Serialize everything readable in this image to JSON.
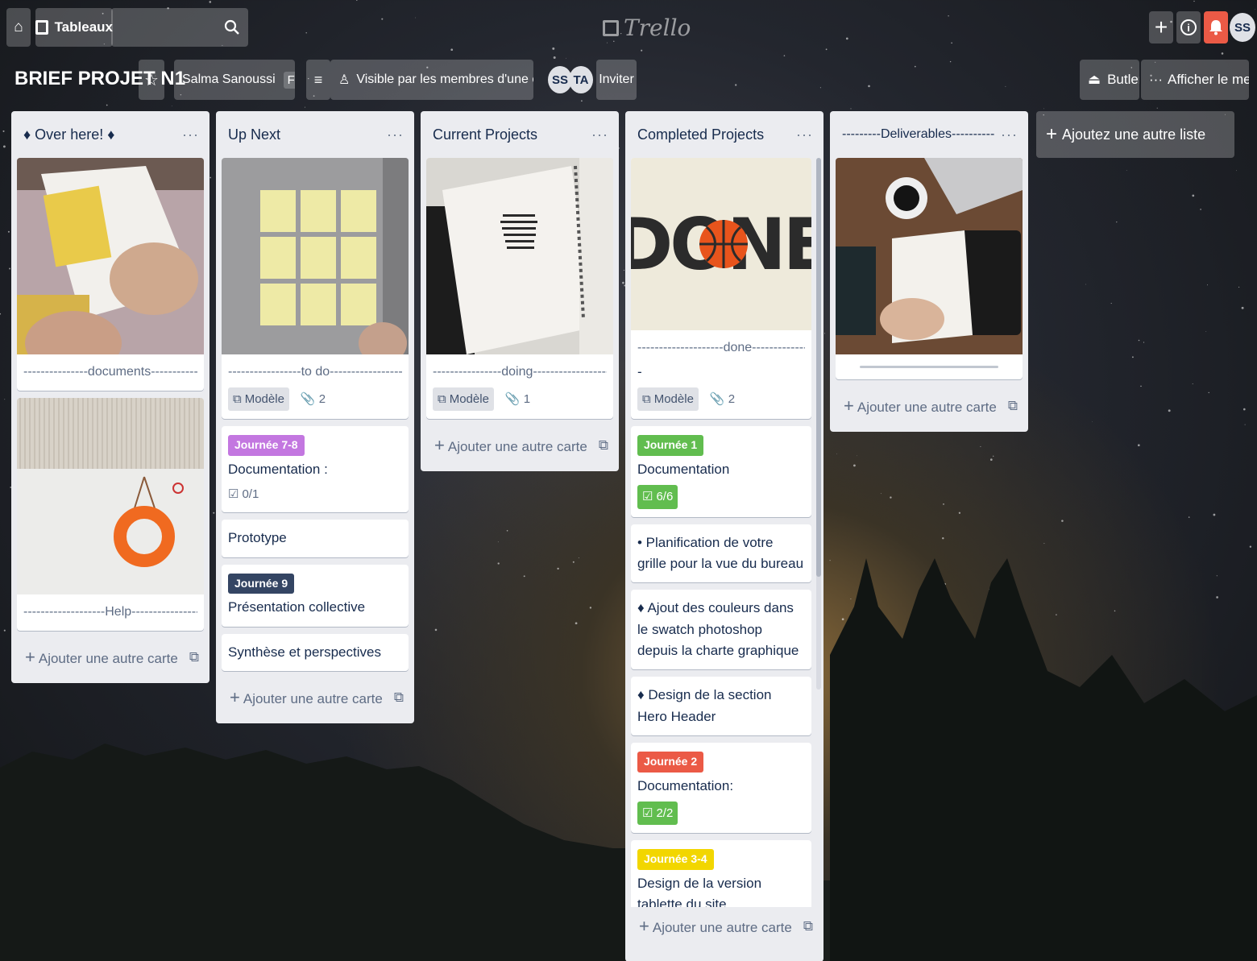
{
  "header": {
    "home_icon": "home-icon",
    "boards_label": "Tableaux",
    "search_icon": "search-icon",
    "logo_text": "Trello",
    "right": {
      "plus_icon": "plus-icon",
      "info_icon": "info-icon",
      "bell_icon": "bell-icon",
      "avatar": "SS"
    }
  },
  "board": {
    "title": "BRIEF PROJET N1",
    "team": "Salma Sanoussi",
    "plan": "Free",
    "visibility": "Visible par les membres d'une équipe",
    "members": [
      "SS",
      "TA"
    ],
    "invite_label": "Inviter",
    "butler_label": "Butler",
    "menu_label": "Afficher le menu"
  },
  "lists": {
    "l0": {
      "title": "♦ Over here! ♦",
      "cards": [
        {
          "divider": "---------------documents---------------"
        },
        {
          "divider": "-------------------Help-------------------"
        }
      ],
      "add_label": "Ajouter une autre carte"
    },
    "l1": {
      "title": "Up Next",
      "cards": [
        {
          "divider": "-----------------to do------------------",
          "template": "Modèle",
          "attachments": "2"
        },
        {
          "label": "Journée 7-8",
          "title": "Documentation :",
          "checklist": "0/1"
        },
        {
          "title": "Prototype"
        },
        {
          "label": "Journée 9",
          "title": "Présentation collective"
        },
        {
          "title": "Synthèse et perspectives"
        }
      ],
      "add_label": "Ajouter une autre carte"
    },
    "l2": {
      "title": "Current Projects",
      "cards": [
        {
          "divider": "----------------doing-------------------",
          "template": "Modèle",
          "attachments": "1"
        }
      ],
      "add_label": "Ajouter une autre carte"
    },
    "l3": {
      "title": "Completed Projects",
      "cards": [
        {
          "cover_text": "DONE",
          "divider": "--------------------done-----------------",
          "desc": "-",
          "template": "Modèle",
          "attachments": "2"
        },
        {
          "label": "Journée 1",
          "title": "Documentation",
          "checklist": "6/6"
        },
        {
          "title": "• Planification de votre grille pour la vue du bureau"
        },
        {
          "title": "♦ Ajout des couleurs dans le swatch photoshop depuis la charte graphique"
        },
        {
          "title": "♦ Design de la section Hero Header"
        },
        {
          "label": "Journée 2",
          "title": "Documentation:",
          "checklist": "2/2"
        },
        {
          "label": "Journée 3-4",
          "title": "Design de la version tablette du site"
        }
      ],
      "add_label": "Ajouter une autre carte"
    },
    "l4": {
      "title": "---------Deliverables----------",
      "add_label": "Ajouter une autre carte"
    }
  },
  "add_list_label": "Ajoutez une autre liste",
  "colors": {
    "label_purple": "#c377e0",
    "label_navy": "#344563",
    "label_green": "#61bd4f",
    "label_red": "#eb5a46",
    "label_yellow": "#f2d600",
    "notif_red": "#eb5a46"
  }
}
